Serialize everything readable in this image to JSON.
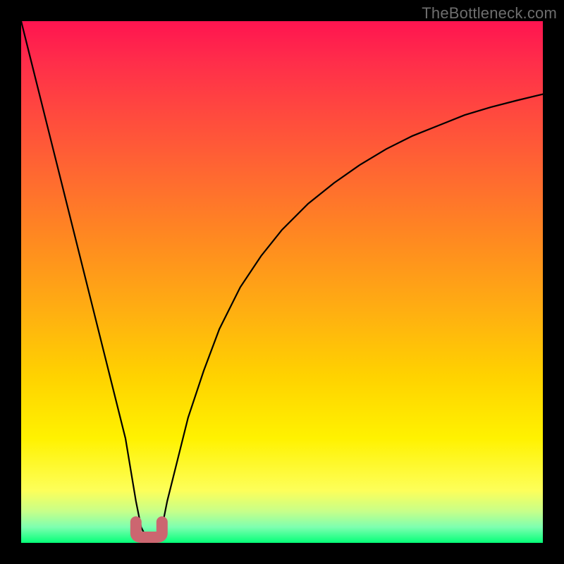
{
  "watermark": "TheBottleneck.com",
  "chart_data": {
    "type": "line",
    "title": "",
    "xlabel": "",
    "ylabel": "",
    "xlim": [
      0,
      100
    ],
    "ylim": [
      0,
      100
    ],
    "categories": [
      0,
      2,
      4,
      6,
      8,
      10,
      12,
      14,
      16,
      18,
      20,
      21,
      22,
      23,
      24,
      25,
      26,
      27,
      28,
      30,
      32,
      35,
      38,
      42,
      46,
      50,
      55,
      60,
      65,
      70,
      75,
      80,
      85,
      90,
      95,
      100
    ],
    "series": [
      {
        "name": "bottleneck-curve",
        "values": [
          100,
          92,
          84,
          76,
          68,
          60,
          52,
          44,
          36,
          28,
          20,
          14,
          8,
          3,
          1,
          0,
          1,
          3,
          8,
          16,
          24,
          33,
          41,
          49,
          55,
          60,
          65,
          69,
          72.5,
          75.5,
          78,
          80,
          82,
          83.5,
          84.8,
          86
        ]
      }
    ],
    "minimum_marker": {
      "shape": "U",
      "x_range": [
        22,
        27
      ],
      "y_range": [
        0,
        4
      ],
      "color": "#cc6670"
    },
    "background_gradient": {
      "top": "#ff1450",
      "middle": "#ffd200",
      "bottom": "#05ff78"
    }
  }
}
